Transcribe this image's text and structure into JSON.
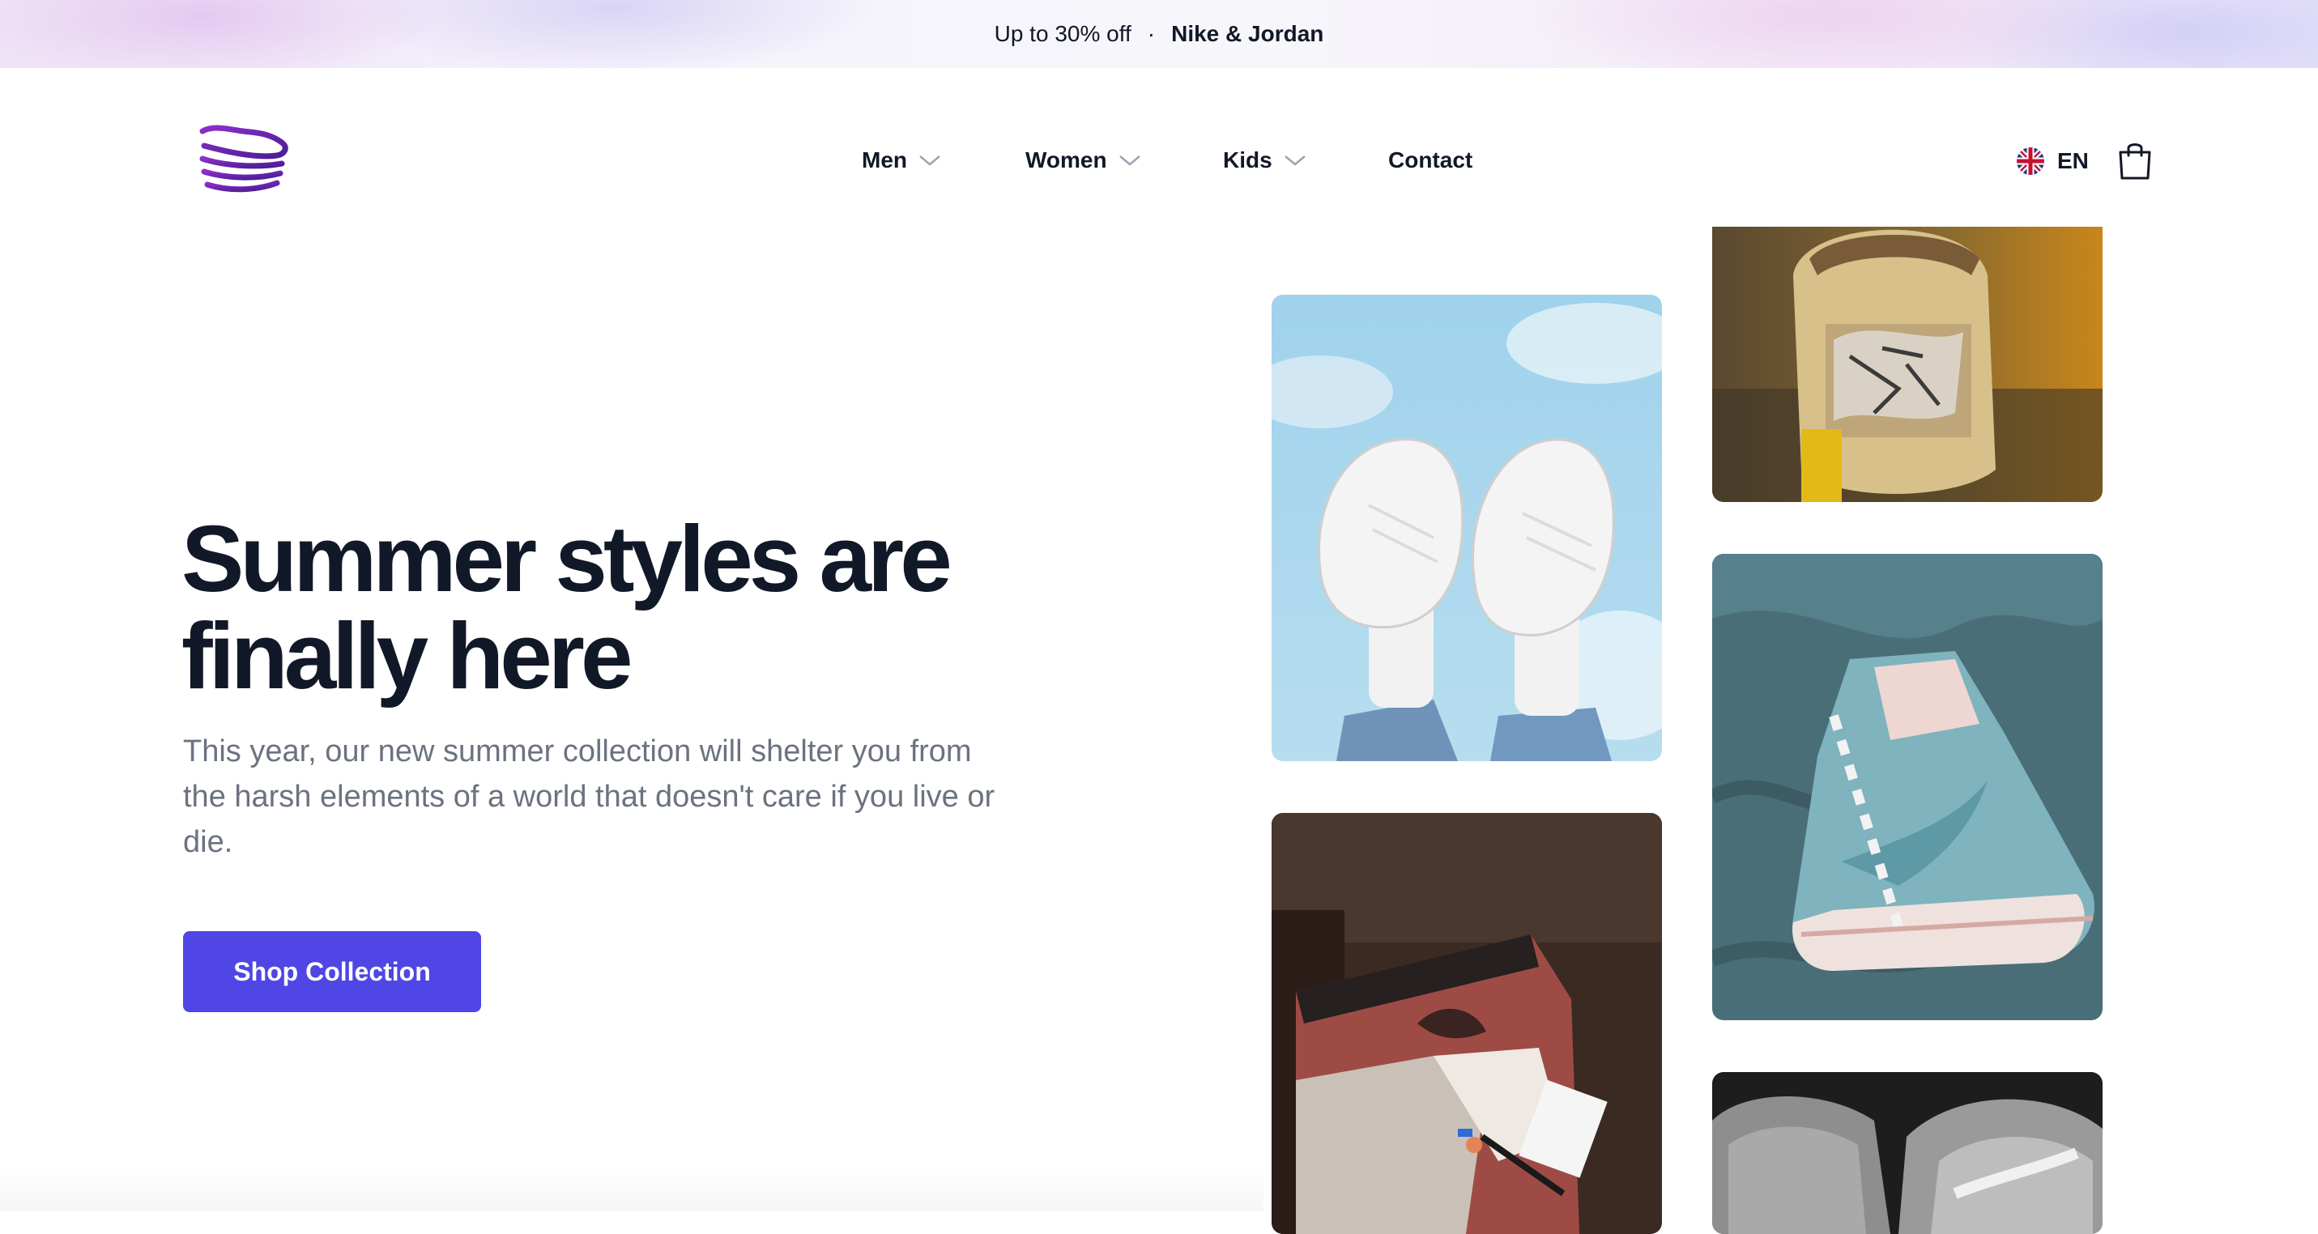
{
  "promo": {
    "offer": "Up to 30% off",
    "separator": "·",
    "brands": "Nike & Jordan"
  },
  "logo": {
    "icon": "stacked-shoe-logo-icon"
  },
  "nav": [
    {
      "label": "Men",
      "has_dropdown": true
    },
    {
      "label": "Women",
      "has_dropdown": true
    },
    {
      "label": "Kids",
      "has_dropdown": true
    },
    {
      "label": "Contact",
      "has_dropdown": false
    }
  ],
  "language": {
    "code": "EN",
    "flag": "uk-flag-icon"
  },
  "cart": {
    "icon": "shopping-bag-icon"
  },
  "hero": {
    "title": "Summer styles are finally here",
    "subtitle": "This year, our new summer collection will shelter you from the harsh elements of a world that doesn't care if you live or die.",
    "cta": "Shop Collection"
  },
  "colors": {
    "accent": "#4f46e5",
    "heading": "#111827",
    "muted": "#6b7280",
    "logo_purple": "#6d28d9"
  },
  "gallery": [
    {
      "name": "white-sneakers-sky-photo"
    },
    {
      "name": "red-jordan-sneaker-photo"
    },
    {
      "name": "tan-nike-sneaker-photo"
    },
    {
      "name": "teal-jordan-sneaker-photo"
    },
    {
      "name": "grey-nike-sneaker-photo"
    }
  ]
}
